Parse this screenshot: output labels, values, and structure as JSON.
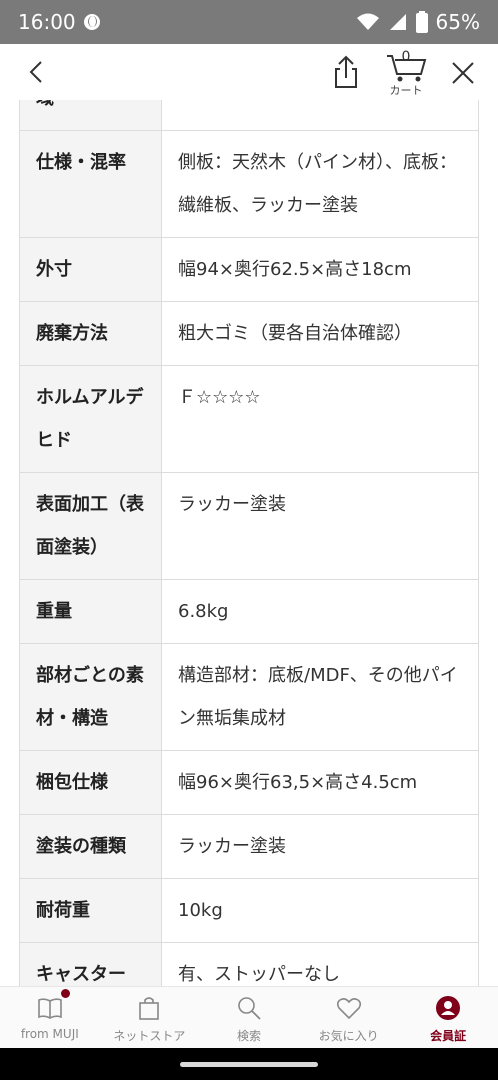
{
  "status_bar": {
    "time": "16:00",
    "battery": "65%"
  },
  "header": {
    "cart_count": "0",
    "cart_label": "カート"
  },
  "spec_rows": [
    {
      "label": "域",
      "value": ""
    },
    {
      "label": "仕様・混率",
      "value": "側板：天然木（パイン材）、底板：繊維板、ラッカー塗装"
    },
    {
      "label": "外寸",
      "value": "幅94×奥行62.5×高さ18cm"
    },
    {
      "label": "廃棄方法",
      "value": "粗大ゴミ（要各自治体確認）"
    },
    {
      "label": "ホルムアルデヒド",
      "value": "Ｆ☆☆☆☆"
    },
    {
      "label": "表面加工（表面塗装）",
      "value": "ラッカー塗装"
    },
    {
      "label": "重量",
      "value": "6.8kg"
    },
    {
      "label": "部材ごとの素材・構造",
      "value": "構造部材：底板/MDF、その他パイン無垢集成材"
    },
    {
      "label": "梱包仕様",
      "value": "幅96×奥行63,5×高さ4.5cm"
    },
    {
      "label": "塗装の種類",
      "value": "ラッカー塗装"
    },
    {
      "label": "耐荷重",
      "value": "10kg"
    },
    {
      "label": "キャスター",
      "value": "有、ストッパーなし"
    }
  ],
  "tabs": [
    {
      "label": "from MUJI",
      "icon": "book-icon"
    },
    {
      "label": "ネットストア",
      "icon": "bag-icon"
    },
    {
      "label": "検索",
      "icon": "search-icon"
    },
    {
      "label": "お気に入り",
      "icon": "heart-icon"
    },
    {
      "label": "会員証",
      "icon": "member-card-icon"
    }
  ],
  "colors": {
    "accent": "#7f0019",
    "status_bar": "#7a7a7a",
    "header_cell": "#f4f4f4"
  }
}
